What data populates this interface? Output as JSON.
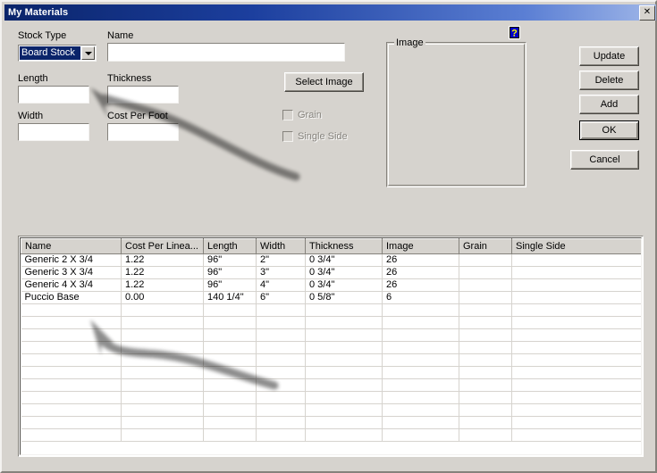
{
  "window": {
    "title": "My Materials",
    "close_label": "✕"
  },
  "form": {
    "stock_type_label": "Stock Type",
    "stock_type_value": "Board Stock",
    "name_label": "Name",
    "name_value": "",
    "length_label": "Length",
    "length_value": "",
    "thickness_label": "Thickness",
    "thickness_value": "",
    "width_label": "Width",
    "width_value": "",
    "cost_per_foot_label": "Cost Per Foot",
    "cost_per_foot_value": "",
    "select_image_label": "Select Image",
    "grain_label": "Grain",
    "single_side_label": "Single Side",
    "image_group_label": "Image",
    "help_icon": "help-question-icon",
    "dropdown_icon": "chevron-down-icon"
  },
  "buttons": {
    "update": "Update",
    "delete": "Delete",
    "add": "Add",
    "ok": "OK",
    "cancel": "Cancel"
  },
  "grid": {
    "columns": [
      "Name",
      "Cost Per Linea...",
      "Length",
      "Width",
      "Thickness",
      "Image",
      "Grain",
      "Single Side"
    ],
    "rows": [
      [
        "Generic 2 X 3/4",
        "1.22",
        "96\"",
        "2\"",
        "0 3/4\"",
        "26",
        "",
        ""
      ],
      [
        "Generic 3 X 3/4",
        "1.22",
        "96\"",
        "3\"",
        "0 3/4\"",
        "26",
        "",
        ""
      ],
      [
        "Generic 4 X 3/4",
        "1.22",
        "96\"",
        "4\"",
        "0 3/4\"",
        "26",
        "",
        ""
      ],
      [
        "Puccio Base",
        "0.00",
        "140 1/4\"",
        "6\"",
        "0 5/8\"",
        "6",
        "",
        ""
      ],
      [
        "",
        "",
        "",
        "",
        "",
        "",
        "",
        ""
      ],
      [
        "",
        "",
        "",
        "",
        "",
        "",
        "",
        ""
      ],
      [
        "",
        "",
        "",
        "",
        "",
        "",
        "",
        ""
      ],
      [
        "",
        "",
        "",
        "",
        "",
        "",
        "",
        ""
      ],
      [
        "",
        "",
        "",
        "",
        "",
        "",
        "",
        ""
      ],
      [
        "",
        "",
        "",
        "",
        "",
        "",
        "",
        ""
      ],
      [
        "",
        "",
        "",
        "",
        "",
        "",
        "",
        ""
      ],
      [
        "",
        "",
        "",
        "",
        "",
        "",
        "",
        ""
      ],
      [
        "",
        "",
        "",
        "",
        "",
        "",
        "",
        ""
      ],
      [
        "",
        "",
        "",
        "",
        "",
        "",
        "",
        ""
      ],
      [
        "",
        "",
        "",
        "",
        "",
        "",
        "",
        ""
      ]
    ]
  },
  "annotations": {
    "arrow_color": "#e8231f",
    "arrow_1_target": "stock-type-dropdown",
    "arrow_2_target": "grid-row-puccio-base"
  },
  "colors": {
    "dialog_face": "#d6d3ce",
    "titlebar_start": "#0a246a",
    "titlebar_end": "#9fb6e8",
    "selection": "#0a246a",
    "arrow_red": "#e8231f"
  }
}
